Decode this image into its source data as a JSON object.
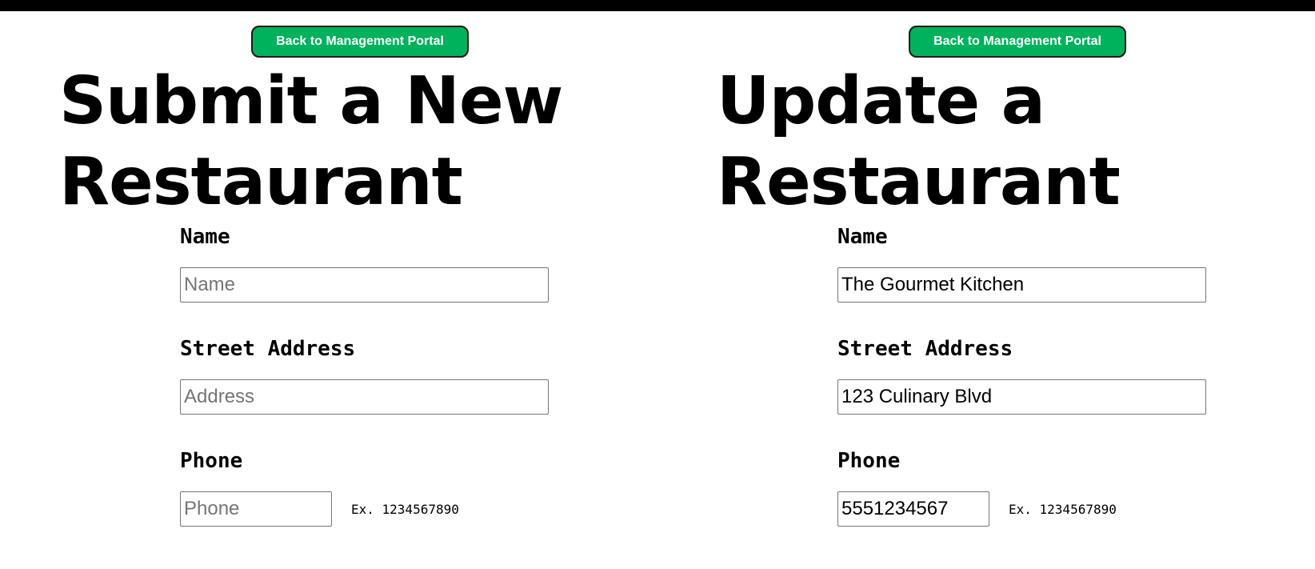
{
  "forms": [
    {
      "back_button": "Back to Management Portal",
      "title": "Submit a New Restaurant",
      "fields": {
        "name": {
          "label": "Name",
          "value": "",
          "placeholder": "Name"
        },
        "address": {
          "label": "Street Address",
          "value": "",
          "placeholder": "Address"
        },
        "phone": {
          "label": "Phone",
          "value": "",
          "placeholder": "Phone",
          "hint": "Ex. 1234567890"
        }
      }
    },
    {
      "back_button": "Back to Management Portal",
      "title": "Update a Restaurant",
      "fields": {
        "name": {
          "label": "Name",
          "value": "The Gourmet Kitchen",
          "placeholder": "Name"
        },
        "address": {
          "label": "Street Address",
          "value": "123 Culinary Blvd",
          "placeholder": "Address"
        },
        "phone": {
          "label": "Phone",
          "value": "5551234567",
          "placeholder": "Phone",
          "hint": "Ex. 1234567890"
        }
      }
    }
  ],
  "colors": {
    "button_bg": "#00b25c",
    "button_border": "#1a1a1a",
    "top_bar": "#000000",
    "placeholder": "#757575"
  }
}
